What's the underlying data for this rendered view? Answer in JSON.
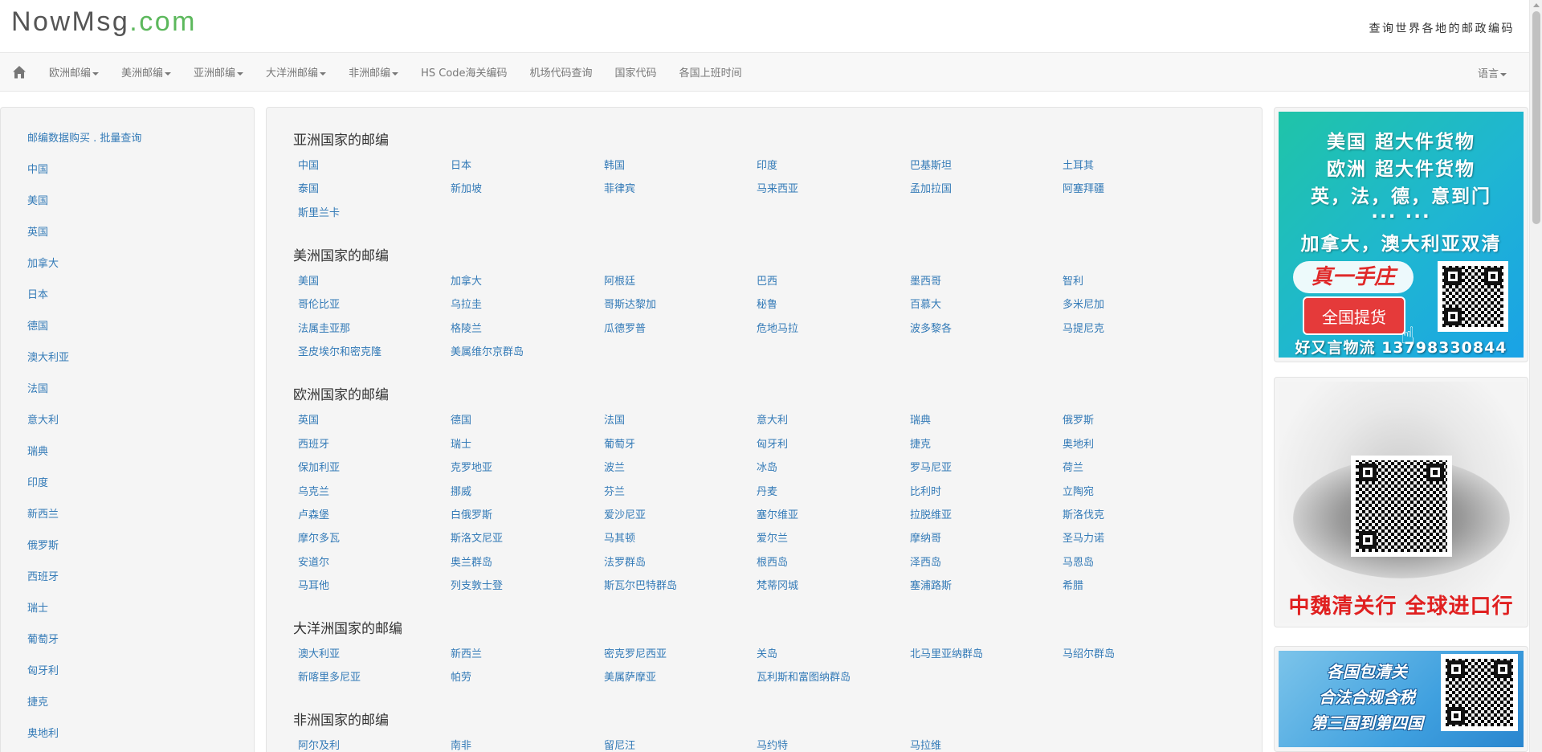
{
  "header": {
    "logo_main": "NowMsg",
    "logo_suffix": ".com",
    "tagline": "查询世界各地的邮政编码"
  },
  "navbar": {
    "home_icon": "home-icon",
    "items": [
      {
        "label": "欧洲邮编",
        "dropdown": true
      },
      {
        "label": "美洲邮编",
        "dropdown": true
      },
      {
        "label": "亚洲邮编",
        "dropdown": true
      },
      {
        "label": "大洋洲邮编",
        "dropdown": true
      },
      {
        "label": "非洲邮编",
        "dropdown": true
      },
      {
        "label": "HS Code海关编码",
        "dropdown": false
      },
      {
        "label": "机场代码查询",
        "dropdown": false
      },
      {
        "label": "国家代码",
        "dropdown": false
      },
      {
        "label": "各国上班时间",
        "dropdown": false
      }
    ],
    "language_label": "语言"
  },
  "sidebar": {
    "items": [
      "邮编数据购买 . 批量查询",
      "中国",
      "美国",
      "英国",
      "加拿大",
      "日本",
      "德国",
      "澳大利亚",
      "法国",
      "意大利",
      "瑞典",
      "印度",
      "新西兰",
      "俄罗斯",
      "西班牙",
      "瑞士",
      "葡萄牙",
      "匈牙利",
      "捷克",
      "奥地利"
    ]
  },
  "main": {
    "sections": [
      {
        "title": "亚洲国家的邮编",
        "countries": [
          "中国",
          "日本",
          "韩国",
          "印度",
          "巴基斯坦",
          "土耳其",
          "泰国",
          "新加坡",
          "菲律宾",
          "马来西亚",
          "孟加拉国",
          "阿塞拜疆",
          "斯里兰卡"
        ]
      },
      {
        "title": "美洲国家的邮编",
        "countries": [
          "美国",
          "加拿大",
          "阿根廷",
          "巴西",
          "墨西哥",
          "智利",
          "哥伦比亚",
          "乌拉圭",
          "哥斯达黎加",
          "秘鲁",
          "百慕大",
          "多米尼加",
          "法属圭亚那",
          "格陵兰",
          "瓜德罗普",
          "危地马拉",
          "波多黎各",
          "马提尼克",
          "圣皮埃尔和密克隆",
          "美属维尔京群岛"
        ]
      },
      {
        "title": "欧洲国家的邮编",
        "countries": [
          "英国",
          "德国",
          "法国",
          "意大利",
          "瑞典",
          "俄罗斯",
          "西班牙",
          "瑞士",
          "葡萄牙",
          "匈牙利",
          "捷克",
          "奥地利",
          "保加利亚",
          "克罗地亚",
          "波兰",
          "冰岛",
          "罗马尼亚",
          "荷兰",
          "乌克兰",
          "挪威",
          "芬兰",
          "丹麦",
          "比利时",
          "立陶宛",
          "卢森堡",
          "白俄罗斯",
          "爱沙尼亚",
          "塞尔维亚",
          "拉脱维亚",
          "斯洛伐克",
          "摩尔多瓦",
          "斯洛文尼亚",
          "马其顿",
          "爱尔兰",
          "摩纳哥",
          "圣马力诺",
          "安道尔",
          "奥兰群岛",
          "法罗群岛",
          "根西岛",
          "泽西岛",
          "马恩岛",
          "马耳他",
          "列支敦士登",
          "斯瓦尔巴特群岛",
          "梵蒂冈城",
          "塞浦路斯",
          "希腊"
        ]
      },
      {
        "title": "大洋洲国家的邮编",
        "countries": [
          "澳大利亚",
          "新西兰",
          "密克罗尼西亚",
          "关岛",
          "北马里亚纳群岛",
          "马绍尔群岛",
          "新喀里多尼亚",
          "帕劳",
          "美属萨摩亚",
          "瓦利斯和富图纳群岛"
        ]
      },
      {
        "title": "非洲国家的邮编",
        "countries": [
          "阿尔及利",
          "南非",
          "留尼汪",
          "马约特",
          "马拉维"
        ]
      }
    ]
  },
  "ads": {
    "ad1": {
      "lines": [
        "美国 超大件货物",
        "欧洲 超大件货物",
        "英，法，德，意到门",
        "... ...",
        "加拿大，澳大利亚双清"
      ],
      "brand": "真一手庄",
      "button": "全国提货",
      "footer": "好又言物流 13798330844"
    },
    "ad2": {
      "text": "中魏清关行 全球进口行"
    },
    "ad3": {
      "lines": [
        "各国包清关",
        "合法合规含税",
        "第三国到第四国"
      ]
    }
  }
}
